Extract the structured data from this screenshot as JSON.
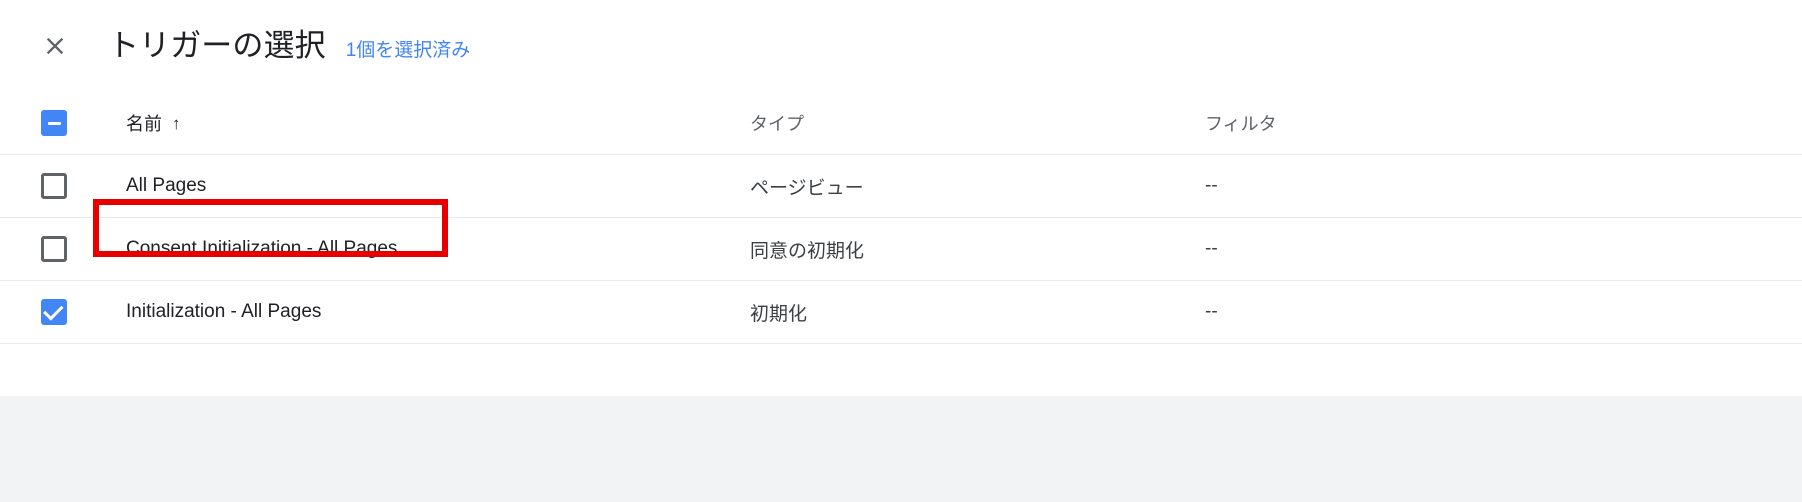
{
  "dialog": {
    "close_icon": "close-icon",
    "title": "トリガーの選択",
    "selected_count_label": "1個を選択済み",
    "accent_color": "#4285f4",
    "annotation_color": "#e60000"
  },
  "table": {
    "header_checkbox_state": "indeterminate",
    "columns": [
      {
        "key": "name",
        "label": "名前",
        "sorted": true,
        "sort_icon": "↑"
      },
      {
        "key": "type",
        "label": "タイプ",
        "sorted": false,
        "sort_icon": ""
      },
      {
        "key": "filter",
        "label": "フィルタ",
        "sorted": false,
        "sort_icon": ""
      }
    ],
    "rows": [
      {
        "checkbox_state": "unchecked",
        "name": "All Pages",
        "type": "ページビュー",
        "filter": "--",
        "highlighted": false
      },
      {
        "checkbox_state": "unchecked",
        "name": "Consent Initialization - All Pages",
        "type": "同意の初期化",
        "filter": "--",
        "highlighted": false
      },
      {
        "checkbox_state": "checked",
        "name": "Initialization - All Pages",
        "type": "初期化",
        "filter": "--",
        "highlighted": true
      }
    ]
  }
}
